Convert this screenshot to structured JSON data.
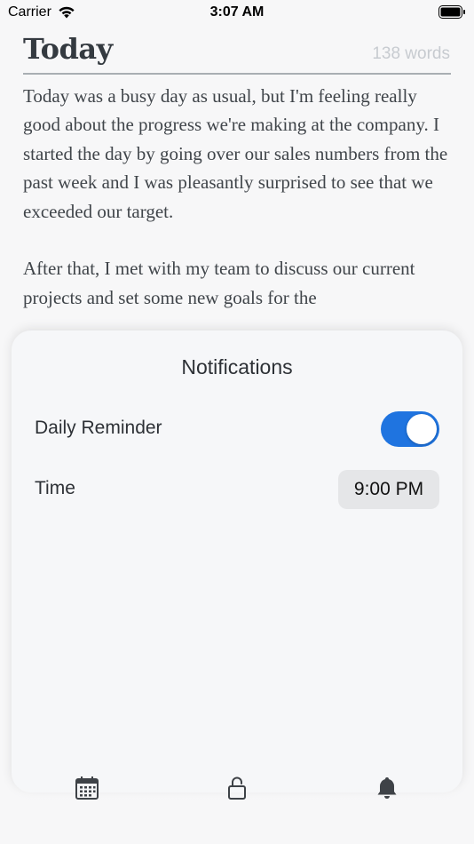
{
  "status_bar": {
    "carrier": "Carrier",
    "time": "3:07 AM"
  },
  "entry": {
    "title": "Today",
    "word_count": "138 words",
    "paragraphs": [
      "Today was a busy day as usual, but I'm feeling really good about the progress we're making at the company. I started the day by going over our sales numbers from the past week and I was pleasantly surprised to see that we exceeded our target.",
      "After that, I met with my team to discuss our current projects and set some new goals for the"
    ]
  },
  "notifications": {
    "title": "Notifications",
    "daily_reminder_label": "Daily Reminder",
    "daily_reminder_on": true,
    "time_label": "Time",
    "time_value": "9:00 PM"
  },
  "tab_bar": {
    "icons": [
      "calendar-icon",
      "unlock-icon",
      "bell-icon"
    ],
    "accent": "#1f74e0"
  }
}
